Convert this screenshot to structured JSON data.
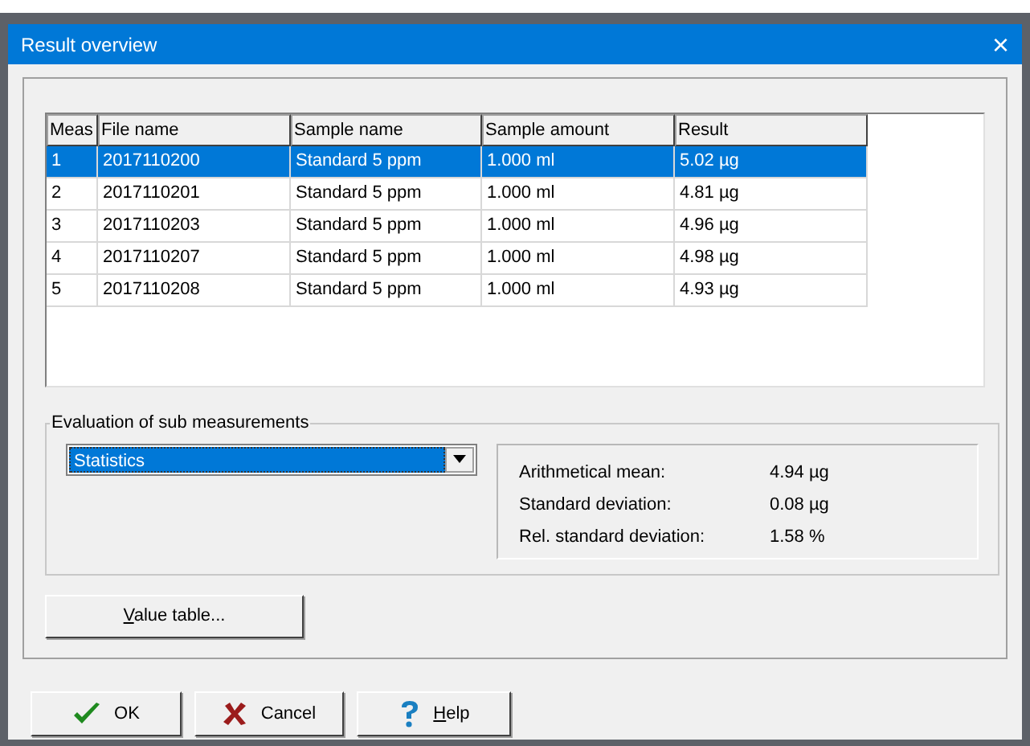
{
  "window": {
    "title": "Result overview",
    "close": "×"
  },
  "table": {
    "columns": [
      "Meas",
      "File name",
      "Sample name",
      "Sample amount",
      "Result"
    ],
    "rows": [
      {
        "cells": [
          "1",
          "2017110200",
          "Standard 5 ppm",
          "1.000 ml",
          "5.02 µg"
        ],
        "selected": true
      },
      {
        "cells": [
          "2",
          "2017110201",
          "Standard 5 ppm",
          "1.000 ml",
          "4.81 µg"
        ],
        "selected": false
      },
      {
        "cells": [
          "3",
          "2017110203",
          "Standard 5 ppm",
          "1.000 ml",
          "4.96 µg"
        ],
        "selected": false
      },
      {
        "cells": [
          "4",
          "2017110207",
          "Standard 5 ppm",
          "1.000 ml",
          "4.98 µg"
        ],
        "selected": false
      },
      {
        "cells": [
          "5",
          "2017110208",
          "Standard 5 ppm",
          "1.000 ml",
          "4.93 µg"
        ],
        "selected": false
      }
    ]
  },
  "evaluation": {
    "title": "Evaluation of sub measurements",
    "dropdown": "Statistics",
    "stats": [
      {
        "label": "Arithmetical mean:",
        "value": "4.94 µg"
      },
      {
        "label": "Standard deviation:",
        "value": "0.08 µg"
      },
      {
        "label": "Rel. standard deviation:",
        "value": "1.58 %"
      }
    ]
  },
  "value_table_button": {
    "label": "Value table...",
    "mnemonic": true
  },
  "buttons": [
    {
      "kind": "ok",
      "label": "OK",
      "mnemonic": false
    },
    {
      "kind": "cancel",
      "label": "Cancel",
      "mnemonic": false
    },
    {
      "kind": "help",
      "label": "Help",
      "mnemonic": true
    }
  ]
}
